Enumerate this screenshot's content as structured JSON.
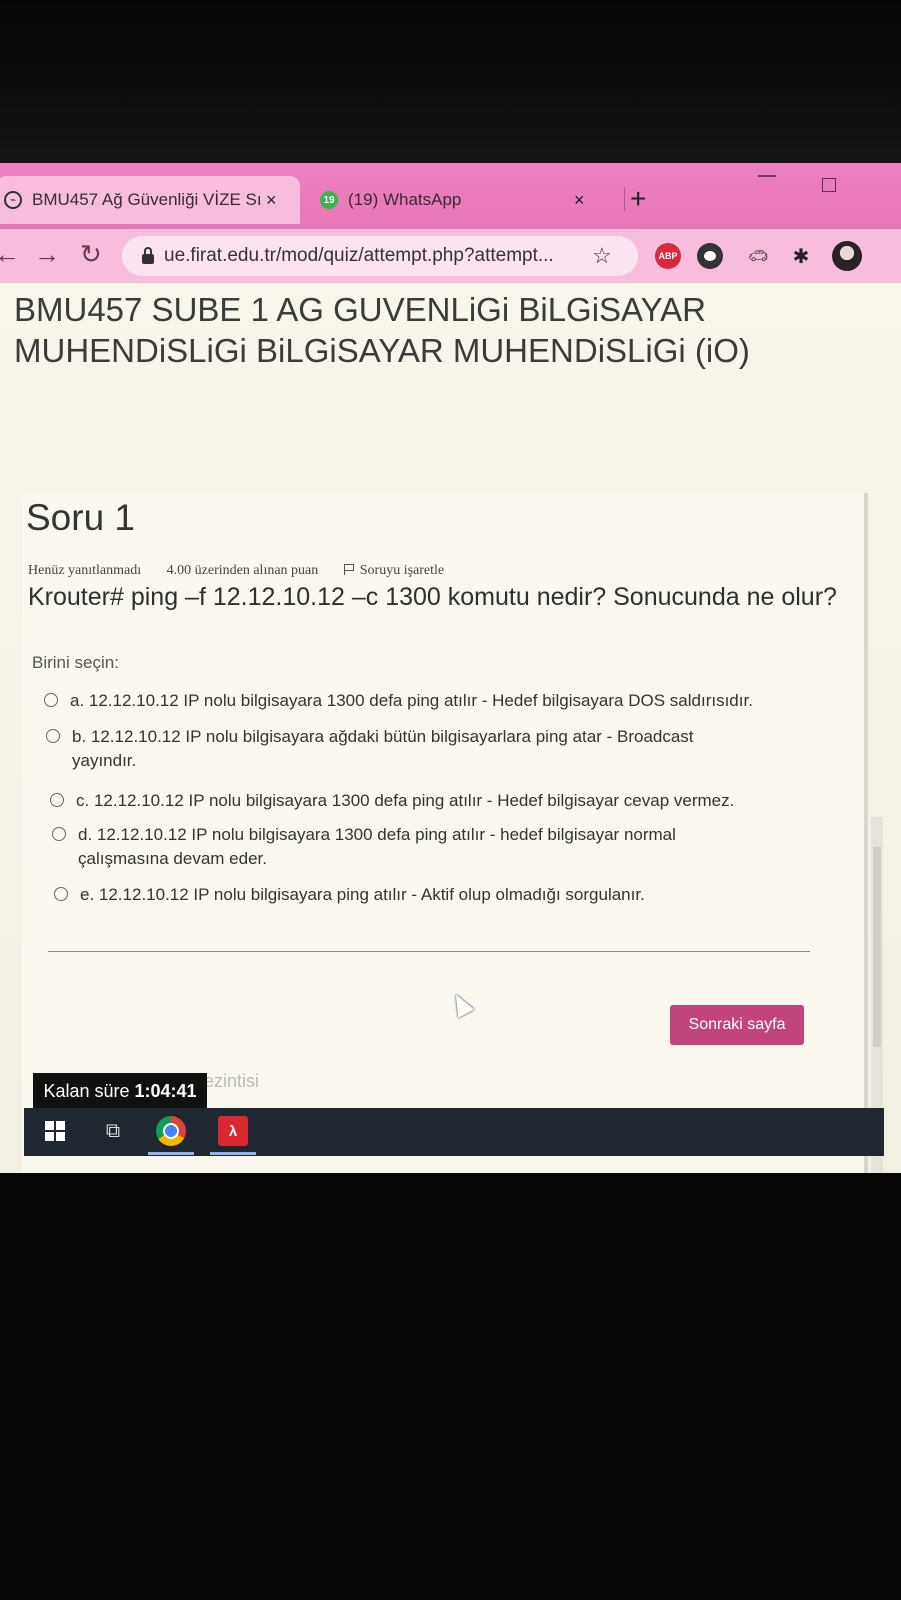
{
  "browser": {
    "tabs": [
      {
        "title": "BMU457 Ağ Güvenliği VİZE Sı",
        "favicon": "moodle-icon",
        "active": true
      },
      {
        "title": "(19) WhatsApp",
        "favicon": "whatsapp-icon",
        "badge": "19",
        "active": false
      }
    ],
    "new_tab_label": "+",
    "close_label": "×",
    "url": "ue.firat.edu.tr/mod/quiz/attempt.php?attempt...",
    "extensions": [
      "ABP"
    ],
    "colors": {
      "tab_strip": "#ee7fbf",
      "toolbar": "#f8bcdc"
    }
  },
  "page": {
    "course_title": "BMU457 SUBE 1 AG GUVENLiGi BiLGiSAYAR MUHENDiSLiGi BiLGiSAYAR MUHENDiSLiGi (iO)",
    "question": {
      "heading": "Soru 1",
      "status": "Henüz yanıtlanmadı",
      "points": "4.00 üzerinden alınan puan",
      "flag_label": "Soruyu işaretle",
      "text": "Krouter# ping –f 12.12.10.12 –c 1300 komutu nedir? Sonucunda ne olur?",
      "prompt": "Birini seçin:",
      "answers": [
        {
          "label": "a. 12.12.10.12 IP nolu bilgisayara 1300 defa ping atılır - Hedef bilgisayara DOS saldırısıdır."
        },
        {
          "label": "b. 12.12.10.12 IP nolu bilgisayara ağdaki bütün bilgisayarlara ping atar - Broadcast yayındır."
        },
        {
          "label": "c. 12.12.10.12 IP nolu bilgisayara 1300 defa ping atılır - Hedef bilgisayar cevap vermez."
        },
        {
          "label": "d. 12.12.10.12 IP nolu bilgisayara 1300 defa ping atılır - hedef bilgisayar normal çalışmasına devam eder."
        },
        {
          "label": "e. 12.12.10.12 IP nolu bilgisayara ping atılır - Aktif olup olmadığı sorgulanır."
        }
      ]
    },
    "next_button": "Sonraki sayfa",
    "partial_link": "ezintisi",
    "timer": {
      "label": "Kalan süre",
      "value": "1:04:41"
    },
    "accent_color": "#c1457a"
  },
  "taskbar": {
    "items": [
      "windows-start-icon",
      "task-view-icon",
      "chrome-icon",
      "acrobat-icon"
    ]
  }
}
